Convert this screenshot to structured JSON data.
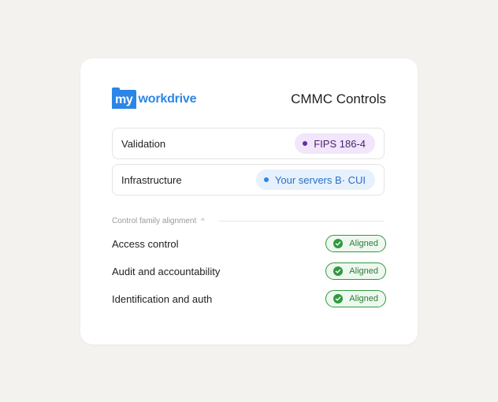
{
  "logo": {
    "prefix": "my",
    "word": "workdrive"
  },
  "header": {
    "title": "CMMC Controls"
  },
  "rows": [
    {
      "label": "Validation",
      "pill": "FIPS 186-4"
    },
    {
      "label": "Infrastructure",
      "pill": "Your servers B· CUI"
    }
  ],
  "section": {
    "label": "Control family alignment",
    "caret": "^"
  },
  "controls": [
    {
      "label": "Access control",
      "status": "Aligned"
    },
    {
      "label": "Audit and accountability",
      "status": "Aligned"
    },
    {
      "label": "Identification and auth",
      "status": "Aligned"
    }
  ],
  "colors": {
    "brand": "#2b86e6",
    "fips_pill_bg": "#f1e6fb",
    "servers_pill_bg": "#e6f1fd",
    "aligned_green": "#2e9a3e",
    "background": "#f3f2ef"
  },
  "icons": {
    "status": "check-circle-icon",
    "dot": "dot-icon",
    "caret": "chevron-up-icon"
  }
}
